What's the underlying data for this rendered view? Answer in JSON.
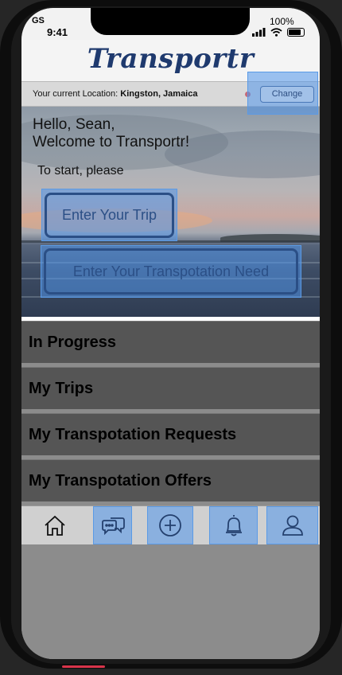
{
  "status_bar": {
    "carrier": "GS",
    "time": "9:41",
    "battery": "100%"
  },
  "header": {
    "app_title": "Transportr"
  },
  "location": {
    "prefix": "Your current Location:",
    "value": "Kingston, Jamaica",
    "change_label": "Change"
  },
  "hero": {
    "greeting_line1": "Hello, Sean,",
    "greeting_line2": "Welcome to Transportr!",
    "prompt": "To start, please",
    "trip_button": "Enter Your Trip",
    "need_button": "Enter Your Transpotation Need"
  },
  "menu": {
    "items": [
      {
        "label": "In Progress"
      },
      {
        "label": "My Trips"
      },
      {
        "label": "My Transpotation Requests"
      },
      {
        "label": "My Transpotation Offers"
      }
    ]
  },
  "tab_bar": {
    "tabs": [
      {
        "icon": "home-icon"
      },
      {
        "icon": "chat-bubbles-icon"
      },
      {
        "icon": "plus-circle-icon"
      },
      {
        "icon": "bell-icon"
      },
      {
        "icon": "user-icon"
      }
    ]
  },
  "colors": {
    "accent": "#2b4f86",
    "highlight": "#5096eb",
    "menu_bg": "#555555"
  }
}
